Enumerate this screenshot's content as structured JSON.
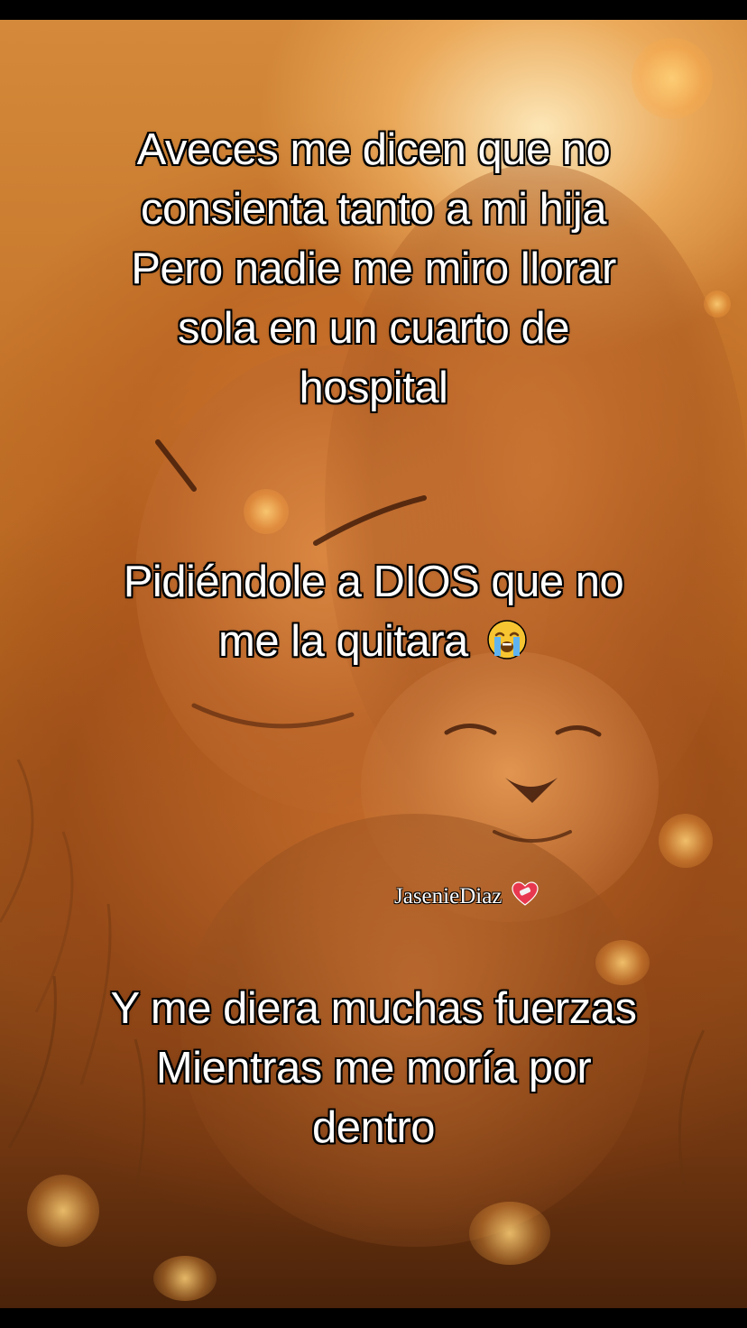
{
  "captions": {
    "block1": {
      "line1": "Aveces me dicen que no",
      "line2": "consienta tanto a mi hija",
      "line3": "Pero nadie me miro llorar",
      "line4": "sola en un cuarto de",
      "line5": "hospital"
    },
    "block2": {
      "line1": "Pidiéndole a DIOS que no",
      "line2": "me la quitara",
      "emoji_icon": "loudly-crying-face-icon"
    },
    "block3": {
      "line1": "Y me diera muchas fuerzas",
      "line2": "Mientras me moría por",
      "line3": "dentro"
    }
  },
  "watermark": {
    "text": "JasenieDiaz",
    "emoji_icon": "mending-heart-icon"
  },
  "colors": {
    "text": "#ffffff",
    "text_outline": "#000000",
    "background_warm": "#c7772c"
  }
}
